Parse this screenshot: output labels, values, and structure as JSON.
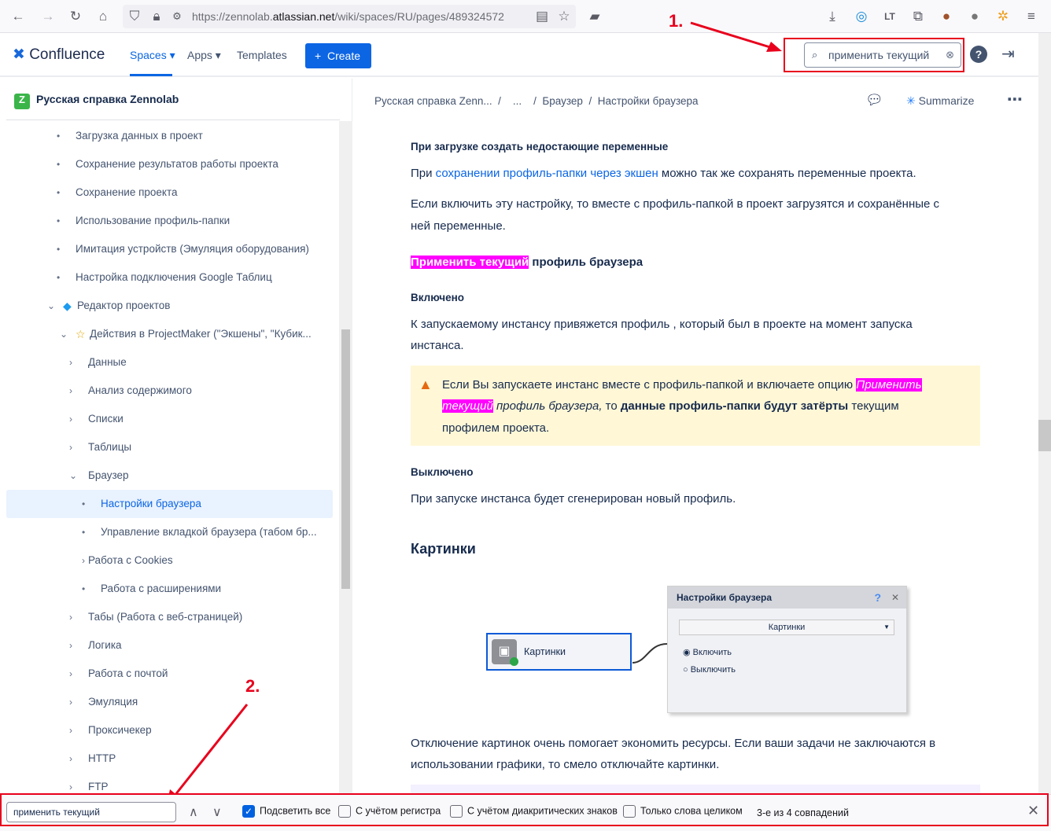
{
  "browser": {
    "url_prefix": "https://zennolab.",
    "url_domain": "atlassian.net",
    "url_path": "/wiki/spaces/RU/pages/489324572"
  },
  "header": {
    "logo": "Confluence",
    "nav": [
      "Spaces",
      "Apps",
      "Templates"
    ],
    "create": "Create",
    "search_value": "применить текущий"
  },
  "annotations": {
    "one": "1.",
    "two": "2."
  },
  "sidebar": {
    "space": "Русская справка Zennolab",
    "items": [
      {
        "label": "Загрузка данных в проект",
        "lvl": 1,
        "t": "bullet"
      },
      {
        "label": "Сохранение результатов работы проекта",
        "lvl": 1,
        "t": "bullet"
      },
      {
        "label": "Сохранение проекта",
        "lvl": 1,
        "t": "bullet"
      },
      {
        "label": "Использование профиль-папки",
        "lvl": 1,
        "t": "bullet"
      },
      {
        "label": "Имитация устройств (Эмуляция оборудования)",
        "lvl": 1,
        "t": "bullet"
      },
      {
        "label": "Настройка подключения Google Таблиц",
        "lvl": 1,
        "t": "bullet"
      },
      {
        "label": "Редактор проектов",
        "lvl": 0,
        "t": "open",
        "icon": "◆"
      },
      {
        "label": "Действия в ProjectMaker (\"Экшены\", \"Кубик...",
        "lvl": 1,
        "t": "open",
        "icon": "☆"
      },
      {
        "label": "Данные",
        "lvl": 2,
        "t": "closed"
      },
      {
        "label": "Анализ содержимого",
        "lvl": 2,
        "t": "closed"
      },
      {
        "label": "Списки",
        "lvl": 2,
        "t": "closed"
      },
      {
        "label": "Таблицы",
        "lvl": 2,
        "t": "closed"
      },
      {
        "label": "Браузер",
        "lvl": 2,
        "t": "open"
      },
      {
        "label": "Настройки браузера",
        "lvl": 3,
        "t": "bullet",
        "active": true
      },
      {
        "label": "Управление вкладкой браузера (табом бр...",
        "lvl": 3,
        "t": "bullet"
      },
      {
        "label": "Работа с Cookies",
        "lvl": 3,
        "t": "closed"
      },
      {
        "label": "Работа с расширениями",
        "lvl": 3,
        "t": "bullet"
      },
      {
        "label": "Табы (Работа с веб-страницей)",
        "lvl": 2,
        "t": "closed"
      },
      {
        "label": "Логика",
        "lvl": 2,
        "t": "closed"
      },
      {
        "label": "Работа с почтой",
        "lvl": 2,
        "t": "closed"
      },
      {
        "label": "Эмуляция",
        "lvl": 2,
        "t": "closed"
      },
      {
        "label": "Проксичекер",
        "lvl": 2,
        "t": "closed"
      },
      {
        "label": "HTTP",
        "lvl": 2,
        "t": "closed"
      },
      {
        "label": "FTP",
        "lvl": 2,
        "t": "closed"
      }
    ]
  },
  "breadcrumb": [
    "Русская справка Zenn...",
    "...",
    "Браузер",
    "Настройки браузера"
  ],
  "summarize": "Summarize",
  "content": {
    "h1": "При загрузке создать недостающие переменные",
    "p1_a": "При ",
    "p1_link": "сохранении профиль-папки через экшен",
    "p1_b": " можно так же сохранять переменные проекта.",
    "p2_l1": "Если включить эту настройку, то вместе с профиль-папкой в проект загрузятся и сохранённые с",
    "p2_l2": "ней переменные.",
    "h2_hl": "Применить текущий",
    "h2_rest": " профиль браузера",
    "h3": "Включено",
    "p3_l1": "К запускаемому инстансу привяжется профиль , который был в проекте на момент запуска",
    "p3_l2": "инстанса.",
    "warn_l1": "Если Вы запускаете инстанс вместе с профиль-папкой и включаете опцию ",
    "warn_hl1": "Применить",
    "warn_hl2": "текущий",
    "warn_it": " профиль браузера,",
    "warn_to": " то ",
    "warn_bold": "данные профиль-папки будут затёрты",
    "warn_end": " текущим",
    "warn_l3": "профилем проекта.",
    "h4": "Выключено",
    "p4": "При запуске инстанса будет сгенерирован новый профиль.",
    "h5": "Картинки",
    "p5_l1": "Отключение картинок очень помогает экономить ресурсы. Если ваши задачи не заключаются в",
    "p5_l2": "использовании графики, то смело отключайте картинки."
  },
  "figure": {
    "node": "Картинки",
    "dialog_title": "Настройки браузера",
    "select": "Картинки",
    "radio_on": "Включить",
    "radio_off": "Выключить"
  },
  "findbar": {
    "value": "применить текущий",
    "highlight_all": "Подсветить все",
    "match_case": "С учётом регистра",
    "diacritics": "С учётом диакритических знаков",
    "whole_words": "Только слова целиком",
    "status": "3-е из 4 совпадений"
  }
}
